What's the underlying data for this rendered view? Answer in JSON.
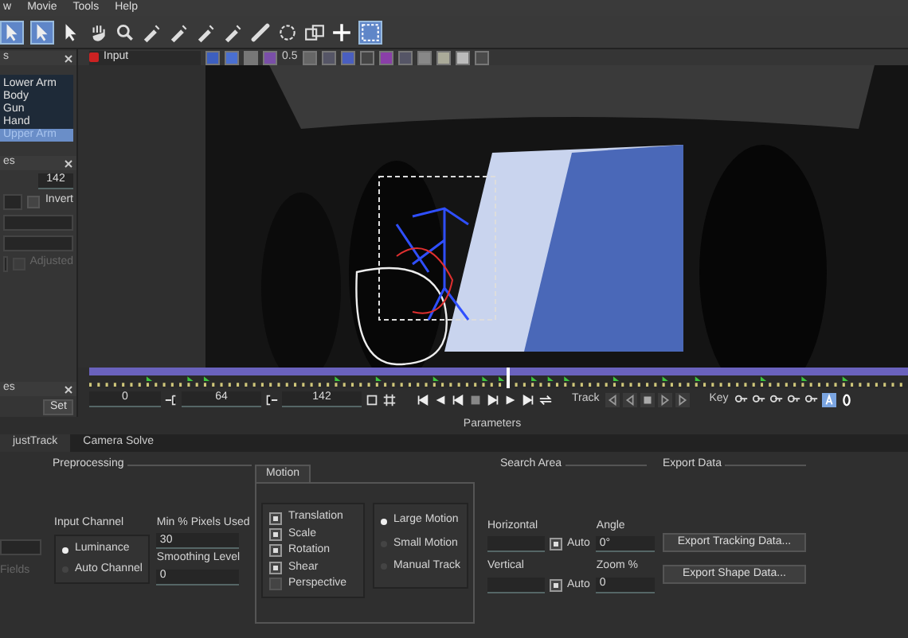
{
  "menu": [
    "w",
    "Movie",
    "Tools",
    "Help"
  ],
  "layers_panel": {
    "title": "s",
    "items": [
      {
        "label": "Lower Arm",
        "selected": false
      },
      {
        "label": "Body",
        "selected": false
      },
      {
        "label": "Gun",
        "selected": false
      },
      {
        "label": "Hand",
        "selected": false
      },
      {
        "label": "Upper Arm",
        "selected": true
      }
    ]
  },
  "layer_properties": {
    "title": "es",
    "frame": "142",
    "invert": {
      "label": "Invert",
      "checked": false
    },
    "adjusted": {
      "label": "Adjusted",
      "checked": false,
      "disabled": true
    }
  },
  "keyframes_panel": {
    "title": "es",
    "set_button": "Set"
  },
  "viewer": {
    "view": "Input",
    "zoom": "0.5"
  },
  "timeline": {
    "playhead": {
      "level": 0.51
    },
    "in_frame": "0",
    "current_frame": "64",
    "out_frame": "142",
    "track_label": "Track",
    "key_label": "Key"
  },
  "parameters": {
    "title": "Parameters",
    "tabs": [
      {
        "label": "justTrack",
        "selected": true
      },
      {
        "label": "Camera Solve",
        "selected": false
      }
    ],
    "preprocessing": {
      "title": "Preprocessing",
      "fields_label": "Fields",
      "input_channel": {
        "label": "Input Channel",
        "options": [
          {
            "label": "Luminance",
            "selected": true
          },
          {
            "label": "Auto Channel",
            "selected": false
          }
        ]
      },
      "min_pixels": {
        "label": "Min % Pixels Used",
        "value": "30"
      },
      "smoothing": {
        "label": "Smoothing Level",
        "value": "0"
      }
    },
    "motion": {
      "title": "Motion",
      "types": [
        {
          "label": "Translation",
          "checked": true
        },
        {
          "label": "Scale",
          "checked": true
        },
        {
          "label": "Rotation",
          "checked": true
        },
        {
          "label": "Shear",
          "checked": true
        },
        {
          "label": "Perspective",
          "checked": false
        }
      ],
      "modes": [
        {
          "label": "Large Motion",
          "selected": true
        },
        {
          "label": "Small Motion",
          "selected": false
        },
        {
          "label": "Manual Track",
          "selected": false
        }
      ]
    },
    "search_area": {
      "title": "Search Area",
      "horizontal": {
        "label": "Horizontal",
        "auto_label": "Auto",
        "auto": true
      },
      "vertical": {
        "label": "Vertical",
        "auto_label": "Auto",
        "auto": true
      },
      "angle": {
        "label": "Angle",
        "value": "0°"
      },
      "zoom": {
        "label": "Zoom %",
        "value": "0"
      }
    },
    "export": {
      "title": "Export Data",
      "buttons": [
        "Export Tracking Data...",
        "Export Shape Data..."
      ]
    }
  }
}
